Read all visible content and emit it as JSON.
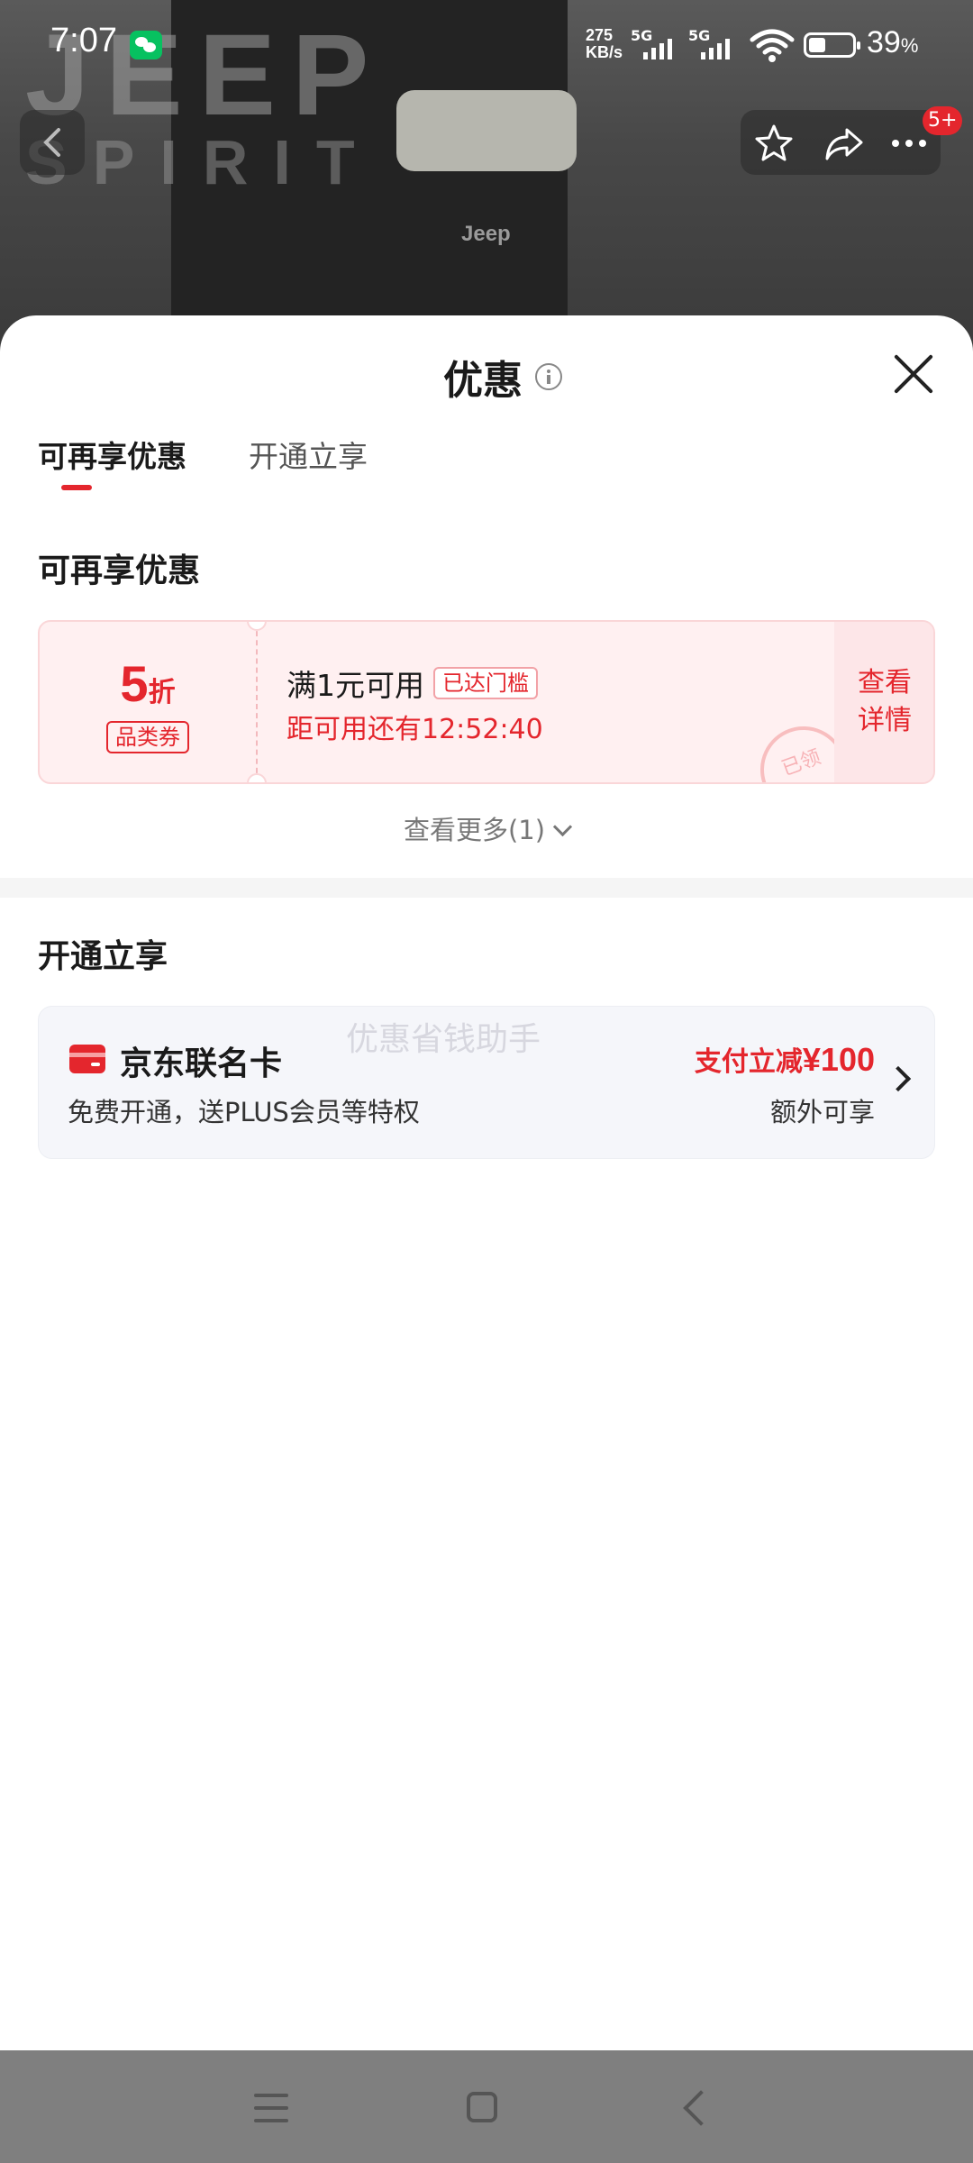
{
  "status_bar": {
    "time": "7:07",
    "net_speed_value": "275",
    "net_speed_unit": "KB/s",
    "signal_1": "5G",
    "signal_2": "5G",
    "battery_pct": "39",
    "battery_pct_unit": "%"
  },
  "hero": {
    "brand_line1": "JEEP",
    "brand_line2": "SPIRIT",
    "garment_logo": "Jeep"
  },
  "nav": {
    "badge": "5+"
  },
  "sheet": {
    "title": "优惠",
    "tabs": [
      "可再享优惠",
      "开通立享"
    ],
    "section_reusable": "可再享优惠",
    "coupon": {
      "discount_value": "5",
      "discount_unit": "折",
      "type": "品类券",
      "condition": "满1元可用",
      "threshold_tag": "已达门槛",
      "timer": "距可用还有12:52:40",
      "detail_line1": "查看",
      "detail_line2": "详情",
      "stamp": "已领"
    },
    "see_more": "查看更多(1)",
    "section_open": "开通立享",
    "card_offer": {
      "name": "京东联名卡",
      "desc": "免费开通，送PLUS会员等特权",
      "saving_prefix": "支付立减",
      "saving_amount": "¥100",
      "extra": "额外可享",
      "watermark": "优惠省钱助手"
    }
  },
  "colors": {
    "accent": "#e4262d",
    "coupon_bg": "#fff0f1",
    "card_bg": "#f5f6fa"
  }
}
